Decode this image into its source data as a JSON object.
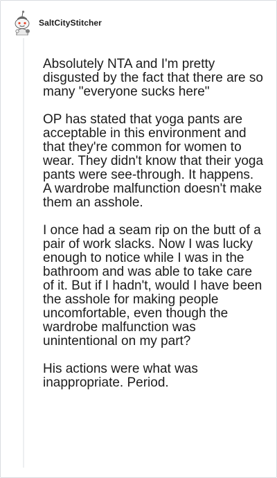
{
  "comment": {
    "author": "SaltCityStitcher",
    "avatar_icon": "snoo-avatar-icon",
    "paragraphs": [
      "Absolutely NTA and I'm pretty disgusted by the fact that there are so many \"everyone sucks here\"",
      "OP has stated that yoga pants are acceptable in this environment and that they're common for women to wear. They didn't know that their yoga pants were see-through. It happens. A wardrobe malfunction doesn't make them an asshole.",
      "I once had a seam rip on the butt of a pair of work slacks. Now I was lucky enough to notice while I was in the bathroom and was able to take care of it. But if I hadn't, would I have been the asshole for making people uncomfortable, even though the wardrobe malfunction was unintentional on my part?",
      "His actions were what was inappropriate. Period."
    ]
  }
}
